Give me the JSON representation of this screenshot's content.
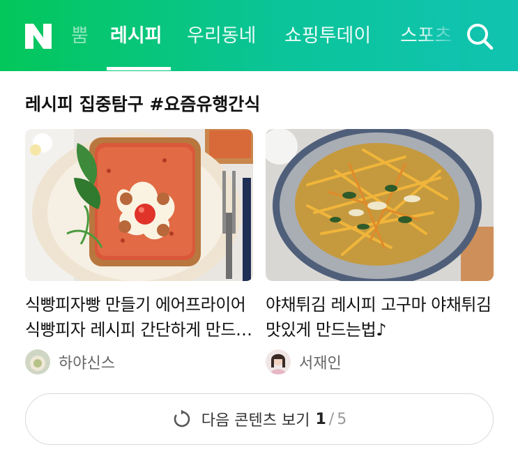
{
  "header": {
    "logo_text": "N",
    "tabs": [
      {
        "label": "뿜",
        "state": "faded"
      },
      {
        "label": "레시피",
        "state": "active"
      },
      {
        "label": "우리동네",
        "state": "normal"
      },
      {
        "label": "쇼핑투데이",
        "state": "normal"
      },
      {
        "label": "스포츠",
        "state": "normal"
      }
    ],
    "search_icon": "search-icon",
    "brand_color": "#03c75a"
  },
  "section": {
    "title": "레시피 집중탐구 #요즘유행간식"
  },
  "cards": [
    {
      "title": "식빵피자빵 만들기 에어프라이어 식빵피자 레시피 간단하게 만드는 법",
      "author": "하야신스"
    },
    {
      "title": "야채튀김 레시피 고구마 야채튀김 맛있게 만드는법♪",
      "author": "서재인"
    }
  ],
  "more": {
    "label": "다음 콘텐츠 보기",
    "current_page": "1",
    "separator": "/",
    "total_pages": "5",
    "icon": "refresh-icon"
  }
}
